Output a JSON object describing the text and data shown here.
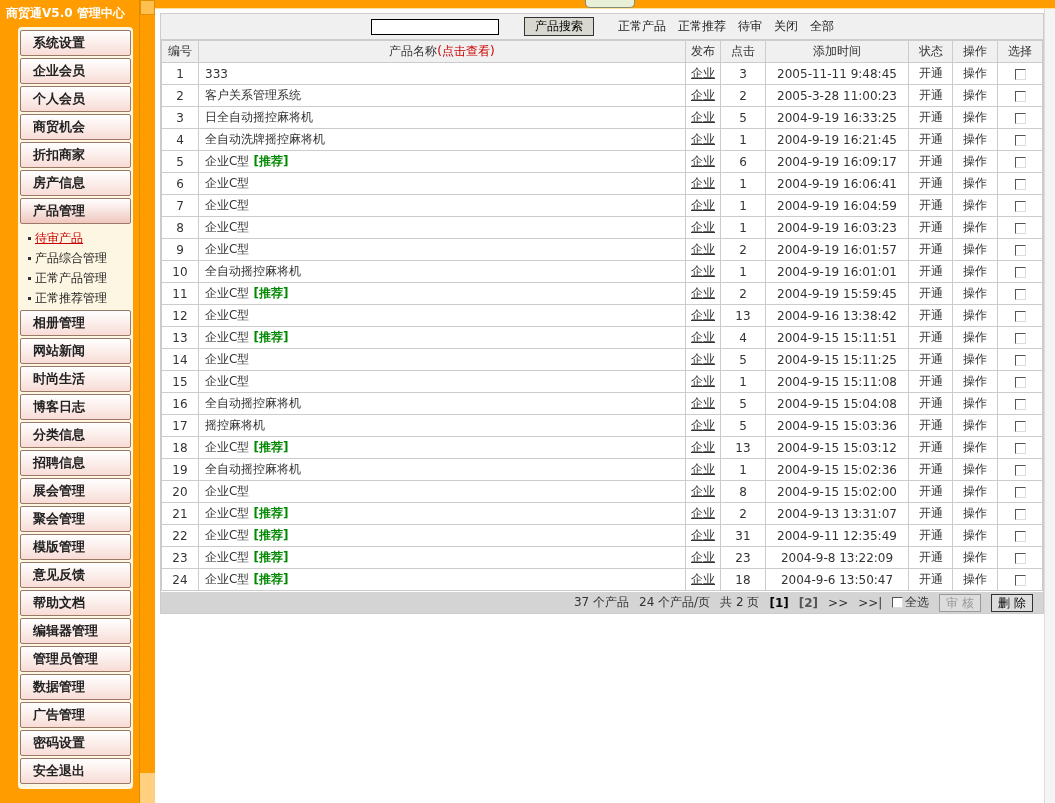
{
  "sidebar": {
    "title": "商贸通V5.0 管理中心",
    "menu": [
      {
        "label": "系统设置",
        "expanded": false
      },
      {
        "label": "企业会员",
        "expanded": false
      },
      {
        "label": "个人会员",
        "expanded": false
      },
      {
        "label": "商贸机会",
        "expanded": false
      },
      {
        "label": "折扣商家",
        "expanded": false
      },
      {
        "label": "房产信息",
        "expanded": false
      },
      {
        "label": "产品管理",
        "expanded": true,
        "children": [
          {
            "label": "待审产品",
            "selected": true
          },
          {
            "label": "产品综合管理",
            "selected": false
          },
          {
            "label": "正常产品管理",
            "selected": false
          },
          {
            "label": "正常推荐管理",
            "selected": false
          }
        ]
      },
      {
        "label": "相册管理",
        "expanded": false
      },
      {
        "label": "网站新闻",
        "expanded": false
      },
      {
        "label": "时尚生活",
        "expanded": false
      },
      {
        "label": "博客日志",
        "expanded": false
      },
      {
        "label": "分类信息",
        "expanded": false
      },
      {
        "label": "招聘信息",
        "expanded": false
      },
      {
        "label": "展会管理",
        "expanded": false
      },
      {
        "label": "聚会管理",
        "expanded": false
      },
      {
        "label": "模版管理",
        "expanded": false
      },
      {
        "label": "意见反馈",
        "expanded": false
      },
      {
        "label": "帮助文档",
        "expanded": false
      },
      {
        "label": "编辑器管理",
        "expanded": false
      },
      {
        "label": "管理员管理",
        "expanded": false
      },
      {
        "label": "数据管理",
        "expanded": false
      },
      {
        "label": "广告管理",
        "expanded": false
      },
      {
        "label": "密码设置",
        "expanded": false
      },
      {
        "label": "安全退出",
        "expanded": false
      }
    ]
  },
  "toolbar": {
    "search_button": "产品搜索",
    "filters": [
      "正常产品",
      "正常推荐",
      "待审",
      "关闭",
      "全部"
    ]
  },
  "table": {
    "columns": [
      {
        "label": "编号"
      },
      {
        "label": "产品名称",
        "hint": "(点击查看)"
      },
      {
        "label": "发布"
      },
      {
        "label": "点击"
      },
      {
        "label": "添加时间"
      },
      {
        "label": "状态"
      },
      {
        "label": "操作"
      },
      {
        "label": "选择"
      }
    ],
    "rows": [
      {
        "no": "1",
        "name": "333",
        "publisher": "企业",
        "clicks": "3",
        "added": "2005-11-11 9:48:45",
        "status": "开通",
        "action": "操作",
        "checked": false
      },
      {
        "no": "2",
        "name": "客户关系管理系统",
        "publisher": "企业",
        "clicks": "2",
        "added": "2005-3-28 11:00:23",
        "status": "开通",
        "action": "操作",
        "checked": false
      },
      {
        "no": "3",
        "name": "日全自动摇控麻将机",
        "publisher": "企业",
        "clicks": "5",
        "added": "2004-9-19 16:33:25",
        "status": "开通",
        "action": "操作",
        "checked": false
      },
      {
        "no": "4",
        "name": "全自动洗牌摇控麻将机",
        "publisher": "企业",
        "clicks": "1",
        "added": "2004-9-19 16:21:45",
        "status": "开通",
        "action": "操作",
        "checked": false
      },
      {
        "no": "5",
        "name": "企业C型",
        "tag": "[推荐]",
        "publisher": "企业",
        "clicks": "6",
        "added": "2004-9-19 16:09:17",
        "status": "开通",
        "action": "操作",
        "checked": false
      },
      {
        "no": "6",
        "name": "企业C型",
        "publisher": "企业",
        "clicks": "1",
        "added": "2004-9-19 16:06:41",
        "status": "开通",
        "action": "操作",
        "checked": false
      },
      {
        "no": "7",
        "name": "企业C型",
        "publisher": "企业",
        "clicks": "1",
        "added": "2004-9-19 16:04:59",
        "status": "开通",
        "action": "操作",
        "checked": false
      },
      {
        "no": "8",
        "name": "企业C型",
        "publisher": "企业",
        "clicks": "1",
        "added": "2004-9-19 16:03:23",
        "status": "开通",
        "action": "操作",
        "checked": false
      },
      {
        "no": "9",
        "name": "企业C型",
        "publisher": "企业",
        "clicks": "2",
        "added": "2004-9-19 16:01:57",
        "status": "开通",
        "action": "操作",
        "checked": false
      },
      {
        "no": "10",
        "name": "全自动摇控麻将机",
        "publisher": "企业",
        "clicks": "1",
        "added": "2004-9-19 16:01:01",
        "status": "开通",
        "action": "操作",
        "checked": false
      },
      {
        "no": "11",
        "name": "企业C型",
        "tag": "[推荐]",
        "publisher": "企业",
        "clicks": "2",
        "added": "2004-9-19 15:59:45",
        "status": "开通",
        "action": "操作",
        "checked": false
      },
      {
        "no": "12",
        "name": "企业C型",
        "publisher": "企业",
        "clicks": "13",
        "added": "2004-9-16 13:38:42",
        "status": "开通",
        "action": "操作",
        "checked": false
      },
      {
        "no": "13",
        "name": "企业C型",
        "tag": "[推荐]",
        "publisher": "企业",
        "clicks": "4",
        "added": "2004-9-15 15:11:51",
        "status": "开通",
        "action": "操作",
        "checked": false
      },
      {
        "no": "14",
        "name": "企业C型",
        "publisher": "企业",
        "clicks": "5",
        "added": "2004-9-15 15:11:25",
        "status": "开通",
        "action": "操作",
        "checked": false
      },
      {
        "no": "15",
        "name": "企业C型",
        "publisher": "企业",
        "clicks": "1",
        "added": "2004-9-15 15:11:08",
        "status": "开通",
        "action": "操作",
        "checked": false
      },
      {
        "no": "16",
        "name": "全自动摇控麻将机",
        "publisher": "企业",
        "clicks": "5",
        "added": "2004-9-15 15:04:08",
        "status": "开通",
        "action": "操作",
        "checked": false
      },
      {
        "no": "17",
        "name": "摇控麻将机",
        "publisher": "企业",
        "clicks": "5",
        "added": "2004-9-15 15:03:36",
        "status": "开通",
        "action": "操作",
        "checked": false
      },
      {
        "no": "18",
        "name": "企业C型",
        "tag": "[推荐]",
        "publisher": "企业",
        "clicks": "13",
        "added": "2004-9-15 15:03:12",
        "status": "开通",
        "action": "操作",
        "checked": false
      },
      {
        "no": "19",
        "name": "全自动摇控麻将机",
        "publisher": "企业",
        "clicks": "1",
        "added": "2004-9-15 15:02:36",
        "status": "开通",
        "action": "操作",
        "checked": false
      },
      {
        "no": "20",
        "name": "企业C型",
        "publisher": "企业",
        "clicks": "8",
        "added": "2004-9-15 15:02:00",
        "status": "开通",
        "action": "操作",
        "checked": false
      },
      {
        "no": "21",
        "name": "企业C型",
        "tag": "[推荐]",
        "publisher": "企业",
        "clicks": "2",
        "added": "2004-9-13 13:31:07",
        "status": "开通",
        "action": "操作",
        "checked": false
      },
      {
        "no": "22",
        "name": "企业C型",
        "tag": "[推荐]",
        "publisher": "企业",
        "clicks": "31",
        "added": "2004-9-11 12:35:49",
        "status": "开通",
        "action": "操作",
        "checked": false
      },
      {
        "no": "23",
        "name": "企业C型",
        "tag": "[推荐]",
        "publisher": "企业",
        "clicks": "23",
        "added": "2004-9-8 13:22:09",
        "status": "开通",
        "action": "操作",
        "checked": false
      },
      {
        "no": "24",
        "name": "企业C型",
        "tag": "[推荐]",
        "publisher": "企业",
        "clicks": "18",
        "added": "2004-9-6 13:50:47",
        "status": "开通",
        "action": "操作",
        "checked": false
      }
    ]
  },
  "footer": {
    "total": "37 个产品",
    "per_page": "24 个产品/页",
    "pages": "共 2 页",
    "page_links": [
      {
        "label": "[1]",
        "selected": true
      },
      {
        "label": "[2]",
        "selected": false
      }
    ],
    "next": ">>",
    "last": ">>|",
    "select_all": {
      "label": "全选",
      "checked": false
    },
    "approve_button": {
      "label": "审 核",
      "disabled": true
    },
    "delete_button": {
      "label": "删 除",
      "disabled": false
    }
  }
}
